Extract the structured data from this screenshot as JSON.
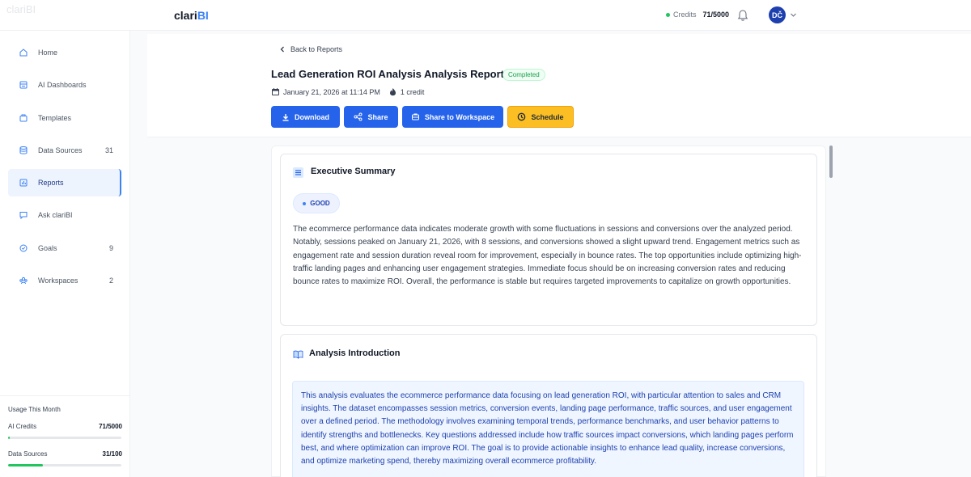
{
  "app": {
    "ghost_logo": "clariBI",
    "logo_main": "clari",
    "logo_accent": "BI"
  },
  "topbar": {
    "credits_label": "Credits",
    "credits_value": "71/5000",
    "avatar_initials": "DČ"
  },
  "sidebar": {
    "items": [
      {
        "label": "Home",
        "icon": "home-icon",
        "count": ""
      },
      {
        "label": "AI Dashboards",
        "icon": "dashboard-icon",
        "count": ""
      },
      {
        "label": "Templates",
        "icon": "template-icon",
        "count": ""
      },
      {
        "label": "Data Sources",
        "icon": "database-icon",
        "count": "31"
      },
      {
        "label": "Reports",
        "icon": "chart-icon",
        "count": ""
      },
      {
        "label": "Ask clariBI",
        "icon": "chat-icon",
        "count": ""
      },
      {
        "label": "Goals",
        "icon": "target-icon",
        "count": "9"
      },
      {
        "label": "Workspaces",
        "icon": "workspace-icon",
        "count": "2"
      }
    ],
    "active_item": "Reports",
    "usage": {
      "title": "Usage This Month",
      "ai_credits_label": "AI Credits",
      "ai_credits_value": "71/5000",
      "ai_credits_fraction": 0.014,
      "data_sources_label": "Data Sources",
      "data_sources_value": "31/100",
      "data_sources_fraction": 0.31
    }
  },
  "report": {
    "back_label": "Back to Reports",
    "title": "Lead Generation ROI Analysis Analysis Report",
    "status": "Completed",
    "date": "January 21, 2026 at 11:14 PM",
    "credits": "1 credit",
    "buttons": {
      "download": "Download",
      "share": "Share",
      "share_workspace": "Share to Workspace",
      "schedule": "Schedule"
    }
  },
  "executive_summary": {
    "title": "Executive Summary",
    "rating": "GOOD",
    "text": "The ecommerce performance data indicates moderate growth with some fluctuations in sessions and conversions over the analyzed period. Notably, sessions peaked on January 21, 2026, with 8 sessions, and conversions showed a slight upward trend. Engagement metrics such as engagement rate and session duration reveal room for improvement, especially in bounce rates. The top opportunities include optimizing high-traffic landing pages and enhancing user engagement strategies. Immediate focus should be on increasing conversion rates and reducing bounce rates to maximize ROI. Overall, the performance is stable but requires targeted improvements to capitalize on growth opportunities."
  },
  "analysis_introduction": {
    "title": "Analysis Introduction",
    "text": "This analysis evaluates the ecommerce performance data focusing on lead generation ROI, with particular attention to sales and CRM insights. The dataset encompasses session metrics, conversion events, landing page performance, traffic sources, and user engagement over a defined period. The methodology involves examining temporal trends, performance benchmarks, and user behavior patterns to identify strengths and bottlenecks. Key questions addressed include how traffic sources impact conversions, which landing pages perform best, and where optimization can improve ROI. The goal is to provide actionable insights to enhance lead quality, increase conversions, and optimize marketing spend, thereby maximizing overall ecommerce profitability."
  },
  "colors": {
    "primary": "#2563eb",
    "schedule": "#fbbf24",
    "success": "#22c55e",
    "avatar": "#1e40af"
  }
}
